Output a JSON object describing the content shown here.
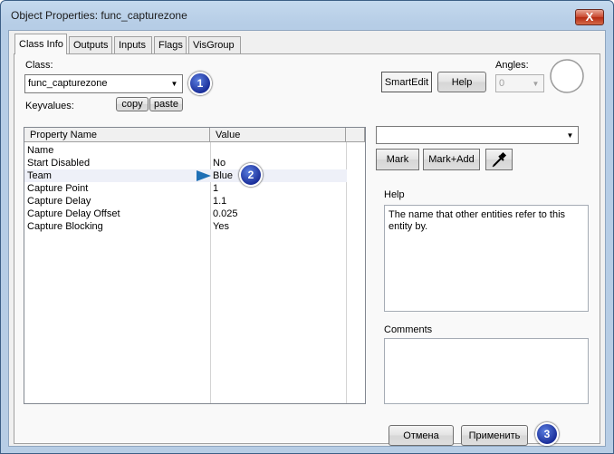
{
  "window": {
    "title": "Object Properties: func_capturezone",
    "close_glyph": "X"
  },
  "tabs": [
    {
      "label": "Class Info"
    },
    {
      "label": "Outputs"
    },
    {
      "label": "Inputs"
    },
    {
      "label": "Flags"
    },
    {
      "label": "VisGroup"
    }
  ],
  "class_section": {
    "class_label": "Class:",
    "class_value": "func_capturezone",
    "keyvalues_label": "Keyvalues:",
    "copy_label": "copy",
    "paste_label": "paste"
  },
  "top_right": {
    "smartedit_label": "SmartEdit",
    "help_label": "Help",
    "angles_label": "Angles:",
    "angles_value": "0"
  },
  "property_list": {
    "headers": [
      "Property Name",
      "Value"
    ],
    "rows": [
      {
        "name": "Name",
        "value": ""
      },
      {
        "name": "Start Disabled",
        "value": "No"
      },
      {
        "name": "Team",
        "value": "Blue"
      },
      {
        "name": "Capture Point",
        "value": "1"
      },
      {
        "name": "Capture Delay",
        "value": "1.1"
      },
      {
        "name": "Capture Delay Offset",
        "value": "0.025"
      },
      {
        "name": "Capture Blocking",
        "value": "Yes"
      }
    ]
  },
  "right_panel": {
    "mark_label": "Mark",
    "mark_add_label": "Mark+Add",
    "help_title": "Help",
    "help_text": "The name that other entities refer to this entity by.",
    "comments_title": "Comments",
    "comments_value": ""
  },
  "footer": {
    "cancel_label": "Отмена",
    "apply_label": "Применить"
  },
  "annotations": {
    "badge1": "1",
    "badge2": "2",
    "badge3": "3"
  },
  "colors": {
    "badge": "#1b2f9a",
    "arrow": "#1e6fb5",
    "selected_row": "#eef0f8"
  }
}
